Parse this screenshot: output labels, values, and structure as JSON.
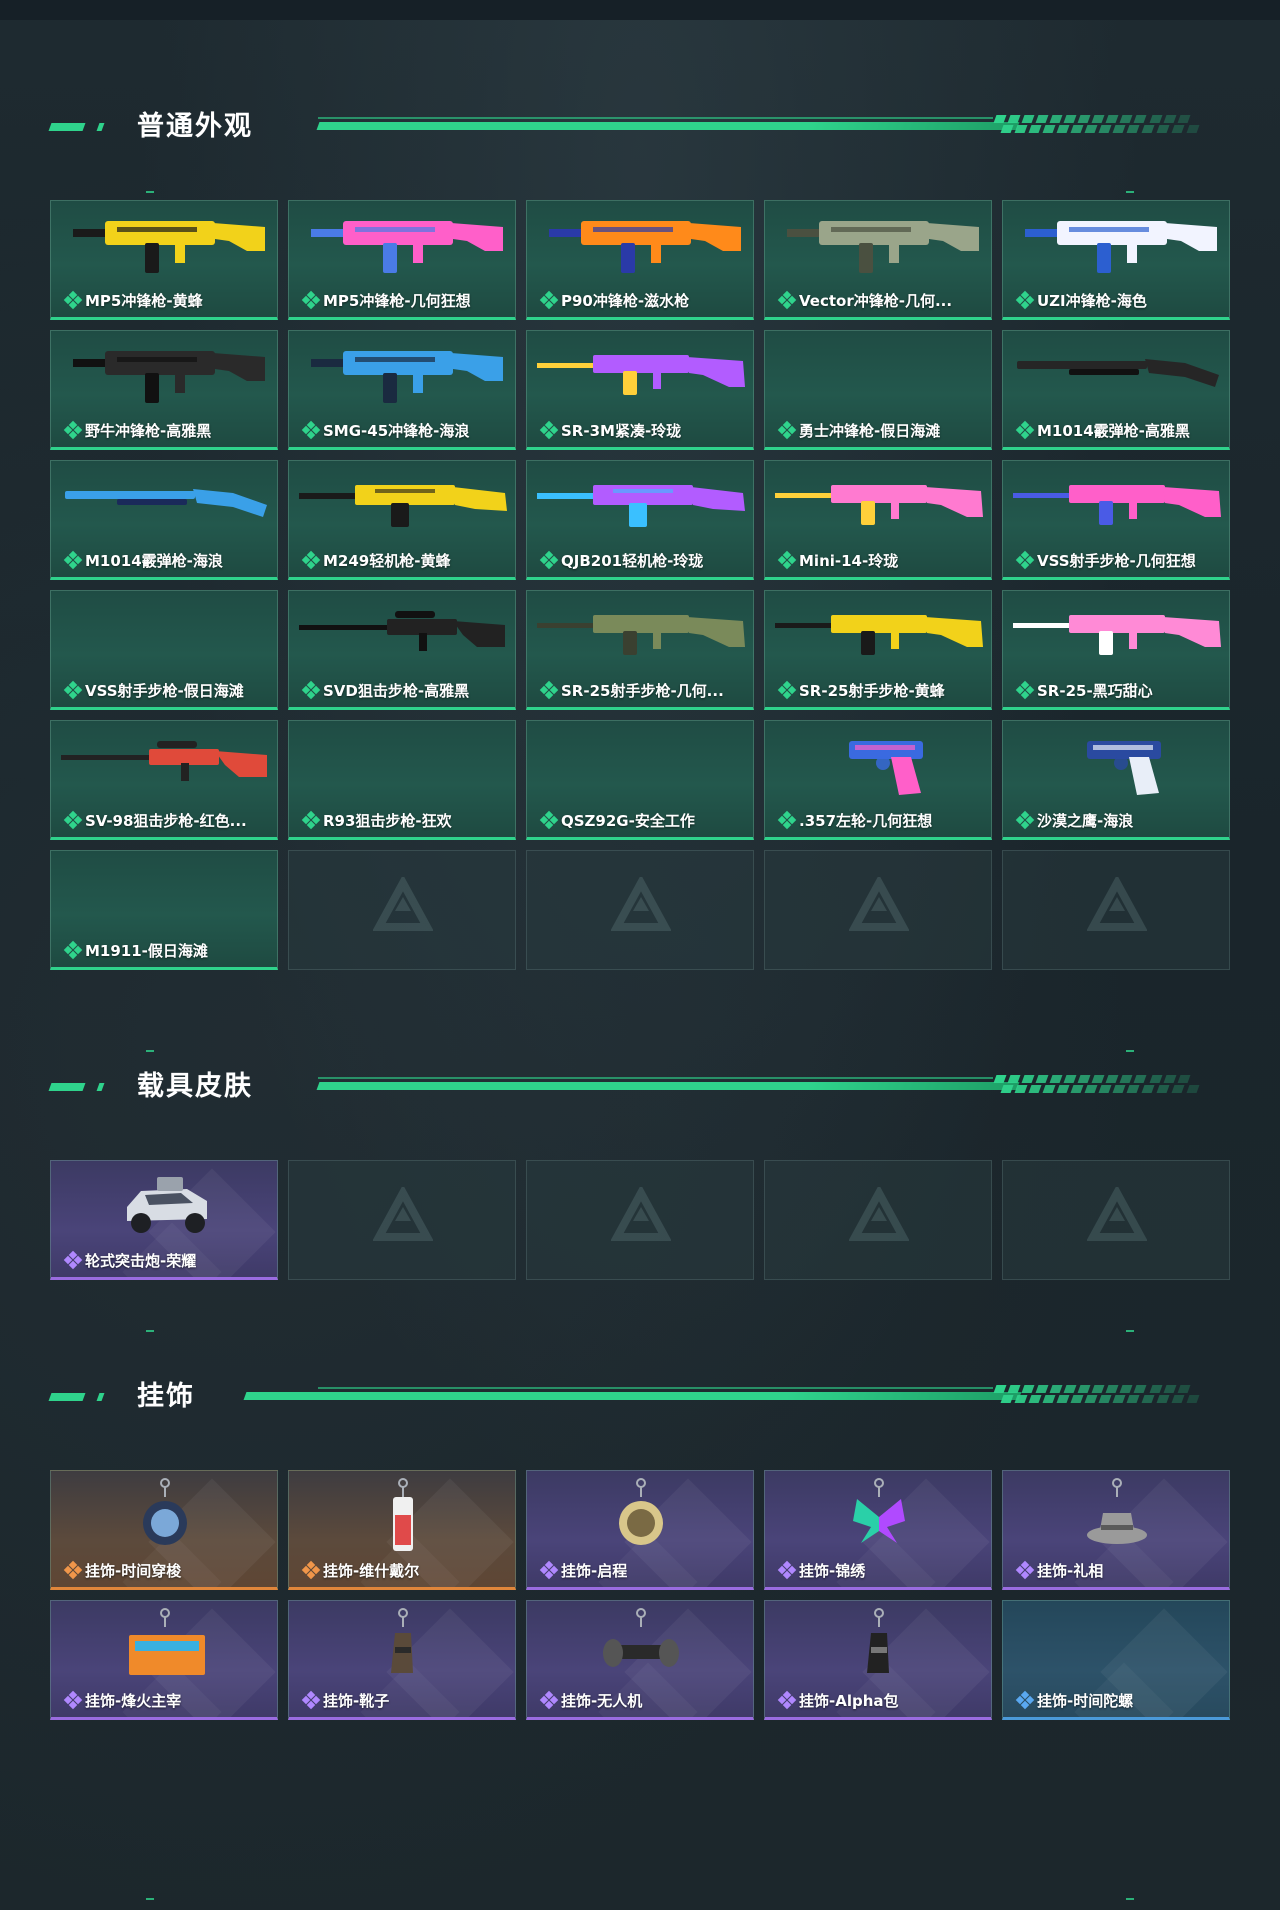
{
  "sections": {
    "weapon": {
      "title": "普通外观"
    },
    "vehicle": {
      "title": "载具皮肤"
    },
    "charm": {
      "title": "挂饰"
    }
  },
  "weapon_skins": [
    {
      "name": "MP5冲锋枪-黄蜂",
      "icon": "smg-icon",
      "colors": [
        "#f2d21a",
        "#1a1a1a"
      ]
    },
    {
      "name": "MP5冲锋枪-几何狂想",
      "icon": "smg-icon",
      "colors": [
        "#ff5fc9",
        "#4a7be6"
      ]
    },
    {
      "name": "P90冲锋枪-滋水枪",
      "icon": "smg-icon",
      "colors": [
        "#ff8a1a",
        "#2a3aa8"
      ]
    },
    {
      "name": "Vector冲锋枪-几何...",
      "icon": "smg-icon",
      "colors": [
        "#9aa58a",
        "#4a5040"
      ]
    },
    {
      "name": "UZI冲锋枪-海色",
      "icon": "smg-icon",
      "colors": [
        "#f2f4ff",
        "#2c5fd0"
      ]
    },
    {
      "name": "野牛冲锋枪-高雅黑",
      "icon": "smg-icon",
      "colors": [
        "#2a2a2a",
        "#111111"
      ]
    },
    {
      "name": "SMG-45冲锋枪-海浪",
      "icon": "smg-icon",
      "colors": [
        "#3aa0e8",
        "#1a2a40"
      ]
    },
    {
      "name": "SR-3M紧凑-玲珑",
      "icon": "rifle-icon",
      "colors": [
        "#b25cff",
        "#ffd03a"
      ]
    },
    {
      "name": "勇士冲锋枪-假日海滩",
      "icon": "smg-icon",
      "colors": [],
      "empty_art": true
    },
    {
      "name": "M1014霰弹枪-高雅黑",
      "icon": "shotgun-icon",
      "colors": [
        "#262626",
        "#111111"
      ]
    },
    {
      "name": "M1014霰弹枪-海浪",
      "icon": "shotgun-icon",
      "colors": [
        "#3aa0e8",
        "#1a2a5a"
      ]
    },
    {
      "name": "M249轻机枪-黄蜂",
      "icon": "lmg-icon",
      "colors": [
        "#f2d21a",
        "#1a1a1a"
      ]
    },
    {
      "name": "QJB201轻机枪-玲珑",
      "icon": "lmg-icon",
      "colors": [
        "#b25cff",
        "#3ac0ff"
      ]
    },
    {
      "name": "Mini-14-玲珑",
      "icon": "rifle-icon",
      "colors": [
        "#ff7ad0",
        "#ffd03a"
      ]
    },
    {
      "name": "VSS射手步枪-几何狂想",
      "icon": "rifle-icon",
      "colors": [
        "#ff5fc9",
        "#4a5be6"
      ]
    },
    {
      "name": "VSS射手步枪-假日海滩",
      "icon": "rifle-icon",
      "colors": [],
      "empty_art": true
    },
    {
      "name": "SVD狙击步枪-高雅黑",
      "icon": "sniper-icon",
      "colors": [
        "#222222",
        "#111111"
      ]
    },
    {
      "name": "SR-25射手步枪-几何...",
      "icon": "rifle-icon",
      "colors": [
        "#7a8a5a",
        "#3a4030"
      ]
    },
    {
      "name": "SR-25射手步枪-黄蜂",
      "icon": "rifle-icon",
      "colors": [
        "#f2d21a",
        "#1a1a1a"
      ]
    },
    {
      "name": "SR-25-黑巧甜心",
      "icon": "rifle-icon",
      "colors": [
        "#ff8ad6",
        "#ffffff"
      ]
    },
    {
      "name": "SV-98狙击步枪-红色...",
      "icon": "sniper-icon",
      "colors": [
        "#e04a3a",
        "#222222"
      ]
    },
    {
      "name": "R93狙击步枪-狂欢",
      "icon": "sniper-icon",
      "colors": [],
      "empty_art": true
    },
    {
      "name": "QSZ92G-安全工作",
      "icon": "pistol-icon",
      "colors": [],
      "empty_art": true
    },
    {
      "name": ".357左轮-几何狂想",
      "icon": "revolver-icon",
      "colors": [
        "#3a6ae0",
        "#ff5fc9"
      ]
    },
    {
      "name": "沙漠之鹰-海浪",
      "icon": "pistol-icon",
      "colors": [
        "#2a4aa0",
        "#e8eef8"
      ]
    },
    {
      "name": "M1911-假日海滩",
      "icon": "pistol-icon",
      "colors": [],
      "empty_art": true
    }
  ],
  "vehicle_skins": [
    {
      "name": "轮式突击炮-荣耀",
      "icon": "armored-car-icon",
      "rarity": "purple"
    }
  ],
  "charms": [
    {
      "name": "挂饰-时间穿梭",
      "icon": "clock-charm-icon",
      "rarity": "orange"
    },
    {
      "name": "挂饰-维什戴尔",
      "icon": "figure-charm-icon",
      "rarity": "orange"
    },
    {
      "name": "挂饰-启程",
      "icon": "emblem-charm-icon",
      "rarity": "purple"
    },
    {
      "name": "挂饰-锦绣",
      "icon": "butterfly-charm-icon",
      "rarity": "purple"
    },
    {
      "name": "挂饰-礼相",
      "icon": "hat-charm-icon",
      "rarity": "purple"
    },
    {
      "name": "挂饰-烽火主宰",
      "icon": "container-charm-icon",
      "rarity": "purple"
    },
    {
      "name": "挂饰-靴子",
      "icon": "boot-charm-icon",
      "rarity": "purple"
    },
    {
      "name": "挂饰-无人机",
      "icon": "drone-charm-icon",
      "rarity": "purple"
    },
    {
      "name": "挂饰-Alpha包",
      "icon": "bag-charm-icon",
      "rarity": "purple"
    },
    {
      "name": "挂饰-时间陀螺",
      "icon": "gyro-charm-icon",
      "rarity": "blue"
    }
  ],
  "theme": {
    "accent_green": "#2fd38c",
    "rarity_purple": "#9a6ce0",
    "rarity_orange": "#e0863b",
    "rarity_blue": "#4b9ad9"
  }
}
